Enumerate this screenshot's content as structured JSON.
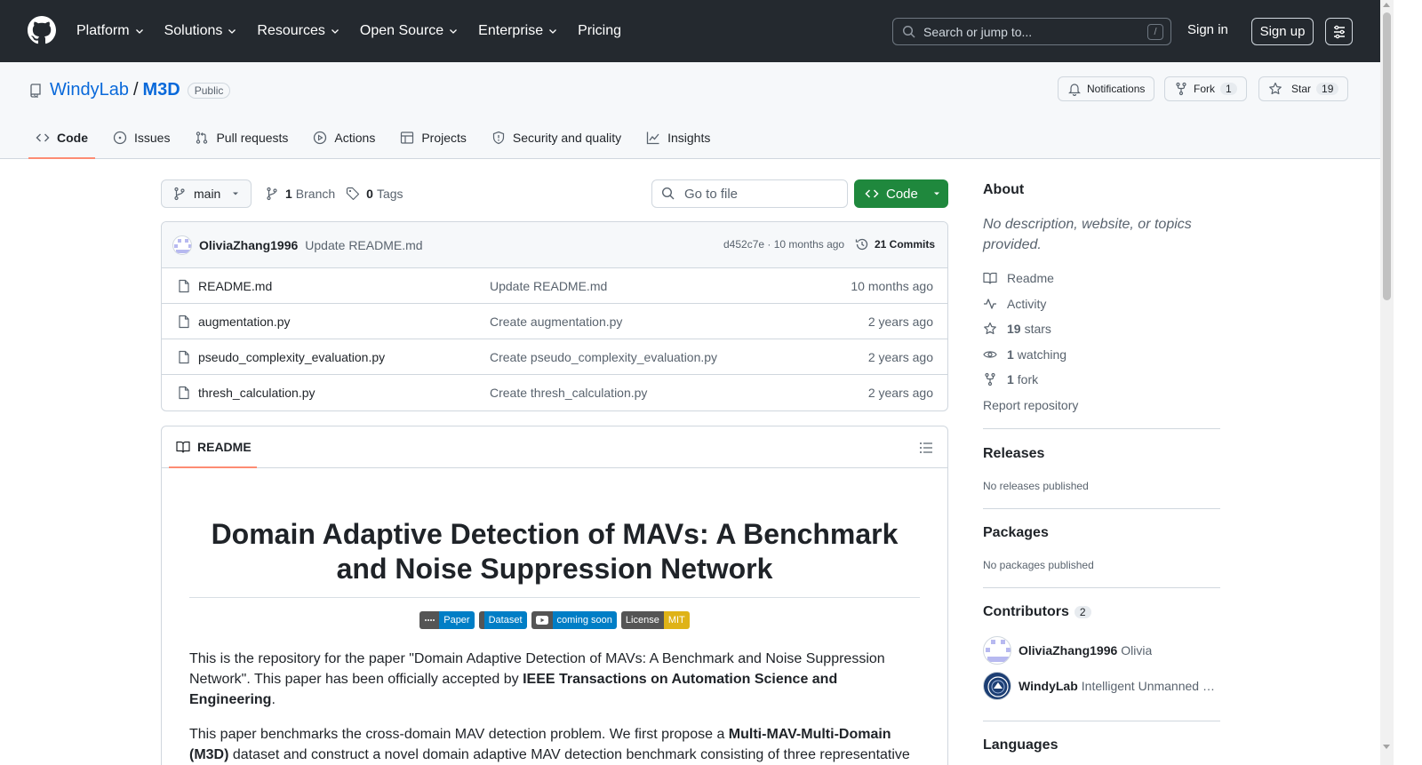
{
  "header": {
    "nav": [
      {
        "label": "Platform",
        "dropdown": true
      },
      {
        "label": "Solutions",
        "dropdown": true
      },
      {
        "label": "Resources",
        "dropdown": true
      },
      {
        "label": "Open Source",
        "dropdown": true
      },
      {
        "label": "Enterprise",
        "dropdown": true
      },
      {
        "label": "Pricing",
        "dropdown": false
      }
    ],
    "search_placeholder": "Search or jump to...",
    "search_shortcut": "/",
    "sign_in": "Sign in",
    "sign_up": "Sign up"
  },
  "repo": {
    "owner": "WindyLab",
    "separator": "/",
    "name": "M3D",
    "visibility": "Public",
    "notifications_label": "Notifications",
    "fork_label": "Fork",
    "fork_count": "1",
    "star_label": "Star",
    "star_count": "19"
  },
  "tabs": [
    {
      "label": "Code",
      "icon": "code-icon",
      "active": true
    },
    {
      "label": "Issues",
      "icon": "issue-icon"
    },
    {
      "label": "Pull requests",
      "icon": "pull-request-icon"
    },
    {
      "label": "Actions",
      "icon": "play-icon"
    },
    {
      "label": "Projects",
      "icon": "table-icon"
    },
    {
      "label": "Security and quality",
      "icon": "shield-icon"
    },
    {
      "label": "Insights",
      "icon": "graph-icon"
    }
  ],
  "toolbar": {
    "branch": "main",
    "branch_count": "1",
    "branch_label": "Branch",
    "tag_count": "0",
    "tag_label": "Tags",
    "go_to_file": "Go to file",
    "code_button": "Code"
  },
  "latest_commit": {
    "author": "OliviaZhang1996",
    "message": "Update README.md",
    "meta": "d452c7e · 10 months ago",
    "commits": "21 Commits"
  },
  "files": [
    {
      "name": "README.md",
      "message": "Update README.md",
      "age": "10 months ago"
    },
    {
      "name": "augmentation.py",
      "message": "Create augmentation.py",
      "age": "2 years ago"
    },
    {
      "name": "pseudo_complexity_evaluation.py",
      "message": "Create pseudo_complexity_evaluation.py",
      "age": "2 years ago"
    },
    {
      "name": "thresh_calculation.py",
      "message": "Create thresh_calculation.py",
      "age": "2 years ago"
    }
  ],
  "readme": {
    "tab_label": "README",
    "title": "Domain Adaptive Detection of MAVs: A Benchmark and Noise Suppression Network",
    "badges": [
      {
        "left": "Paper",
        "right": "",
        "left_color": "#555555",
        "right_color": "#007ec6"
      },
      {
        "left": "Dataset",
        "right": "",
        "left_color": "#007ec6",
        "right_color": "#007ec6"
      },
      {
        "left": "coming soon",
        "right": "",
        "left_color": "#007ec6",
        "right_color": "#007ec6"
      },
      {
        "left": "License",
        "right": "MIT",
        "left_color": "#555555",
        "right_color": "#dfb317"
      }
    ],
    "p1_a": "This is the repository for the paper \"Domain Adaptive Detection of MAVs: A Benchmark and Noise Suppression Network\". This paper has been officially accepted by ",
    "p1_b": "IEEE Transactions on Automation Science and Engineering",
    "p1_c": ".",
    "p2_a": "This paper benchmarks the cross-domain MAV detection problem. We first propose a ",
    "p2_b": "Multi-MAV-Multi-Domain (M3D)",
    "p2_c": " dataset and construct a novel domain adaptive MAV detection benchmark consisting of three representative domain adaptation tasks. Then, we propose a domain adaptive MAV detection framework."
  },
  "sidebar": {
    "about_title": "About",
    "about_desc": "No description, website, or topics provided.",
    "links": [
      {
        "icon": "book-icon",
        "count": "",
        "label": "Readme"
      },
      {
        "icon": "pulse-icon",
        "count": "",
        "label": "Activity"
      },
      {
        "icon": "star-icon",
        "count": "19",
        "label": "stars"
      },
      {
        "icon": "eye-icon",
        "count": "1",
        "label": "watching"
      },
      {
        "icon": "fork-icon",
        "count": "1",
        "label": "fork"
      }
    ],
    "report": "Report repository",
    "releases_title": "Releases",
    "releases_text": "No releases published",
    "packages_title": "Packages",
    "packages_text": "No packages published",
    "contributors_title": "Contributors",
    "contributors_count": "2",
    "contributors": [
      {
        "login": "OliviaZhang1996",
        "name": "Olivia"
      },
      {
        "login": "WindyLab",
        "name": "Intelligent Unmanned Systems Laboratory"
      }
    ],
    "languages_title": "Languages"
  },
  "colors": {
    "header_bg": "#24292f",
    "link": "#0969da",
    "primary_button": "#1f883d",
    "tab_underline": "#fd8c73"
  }
}
